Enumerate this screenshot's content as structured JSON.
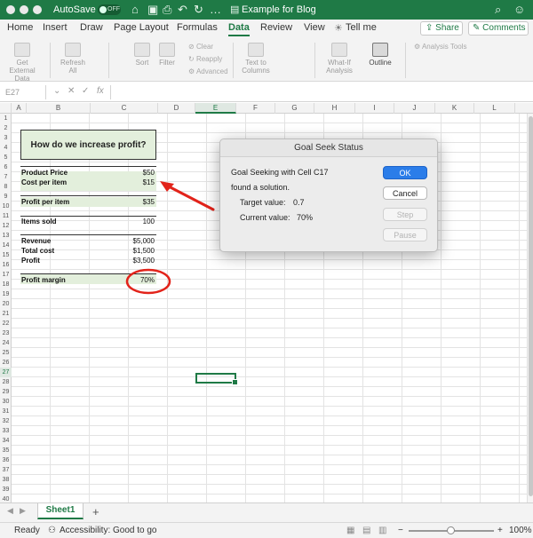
{
  "titlebar": {
    "autosave_label": "AutoSave",
    "autosave_state": "OFF",
    "doc_title": "Example for Blog",
    "background": "#1f7a46"
  },
  "ribbon_tabs": [
    "Home",
    "Insert",
    "Draw",
    "Page Layout",
    "Formulas",
    "Data",
    "Review",
    "View",
    "Tell me"
  ],
  "active_tab": "Data",
  "share_label": "Share",
  "comments_label": "Comments",
  "ribbon": {
    "get_external": "Get External Data",
    "refresh_all": "Refresh All",
    "sort": "Sort",
    "filter": "Filter",
    "clear": "Clear",
    "reapply": "Reapply",
    "advanced": "Advanced",
    "text_to_columns": "Text to Columns",
    "what_if": "What-If Analysis",
    "outline": "Outline",
    "analysis_tools": "Analysis Tools"
  },
  "formula_bar": {
    "name_box": "E27",
    "fx": "fx",
    "cancel": "✕",
    "confirm": "✓"
  },
  "columns": [
    "A",
    "B",
    "C",
    "D",
    "E",
    "F",
    "G",
    "H",
    "I",
    "J",
    "K",
    "L"
  ],
  "selected_column": "E",
  "rows": [
    "1",
    "2",
    "3",
    "4",
    "5",
    "6",
    "7",
    "8",
    "9",
    "10",
    "11",
    "12",
    "13",
    "14",
    "15",
    "16",
    "17",
    "18",
    "19",
    "20",
    "21",
    "22",
    "23",
    "24",
    "25",
    "26",
    "27",
    "28",
    "29",
    "30",
    "31",
    "32",
    "33",
    "34",
    "35",
    "36",
    "37",
    "38",
    "39",
    "40"
  ],
  "selected_row": "27",
  "sheet": {
    "title": "How do we increase profit?",
    "product_price_label": "Product Price",
    "product_price": "$50",
    "cost_per_item_label": "Cost per item",
    "cost_per_item": "$15",
    "profit_per_item_label": "Profit per item",
    "profit_per_item": "$35",
    "items_sold_label": "Items sold",
    "items_sold": "100",
    "revenue_label": "Revenue",
    "revenue": "$5,000",
    "total_cost_label": "Total cost",
    "total_cost": "$1,500",
    "profit_label": "Profit",
    "profit": "$3,500",
    "profit_margin_label": "Profit margin",
    "profit_margin": "70%"
  },
  "dialog": {
    "title": "Goal Seek Status",
    "line1": "Goal Seeking with Cell C17",
    "line2": "found a solution.",
    "target_label": "Target value:",
    "target_value": "0.7",
    "current_label": "Current value:",
    "current_value": "70%",
    "ok": "OK",
    "cancel": "Cancel",
    "step": "Step",
    "pause": "Pause"
  },
  "annotation_color": "#e2231a",
  "sheet_tab": "Sheet1",
  "add_sheet": "+",
  "status": {
    "ready": "Ready",
    "accessibility": "Accessibility: Good to go",
    "zoom": "100%",
    "zoom_minus": "−",
    "zoom_plus": "+",
    "zoom_level": 0.5
  }
}
